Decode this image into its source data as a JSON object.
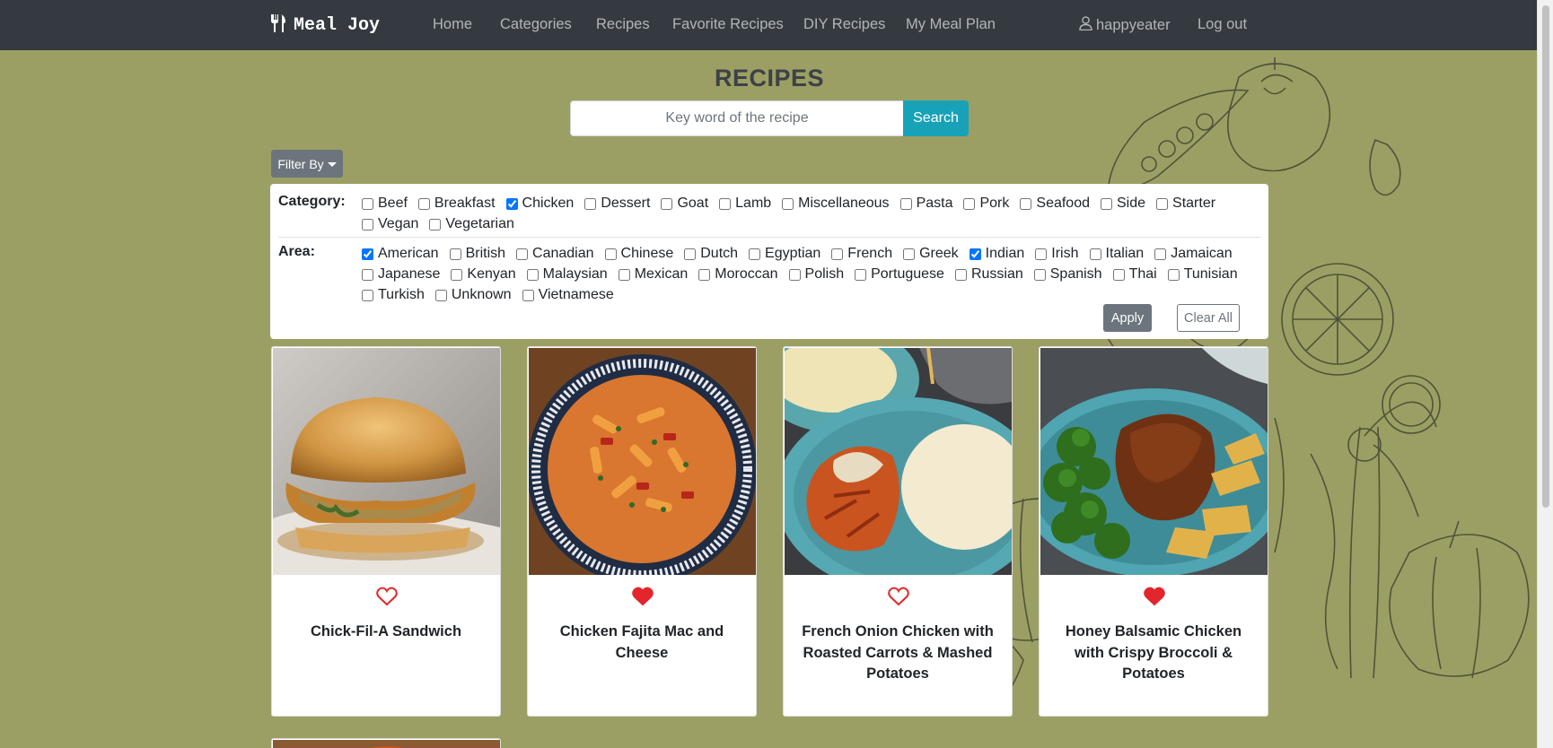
{
  "navbar": {
    "brand": "Meal Joy",
    "links": [
      "Home",
      "Categories",
      "Recipes",
      "Favorite Recipes",
      "DIY Recipes",
      "My Meal Plan"
    ],
    "user": "happyeater",
    "logout": "Log out"
  },
  "page": {
    "title": "RECIPES",
    "search_placeholder": "Key word of the recipe",
    "search_button": "Search",
    "filter_button": "Filter By"
  },
  "filter": {
    "category_label": "Category:",
    "categories": [
      {
        "label": "Beef",
        "checked": false
      },
      {
        "label": "Breakfast",
        "checked": false
      },
      {
        "label": "Chicken",
        "checked": true
      },
      {
        "label": "Dessert",
        "checked": false
      },
      {
        "label": "Goat",
        "checked": false
      },
      {
        "label": "Lamb",
        "checked": false
      },
      {
        "label": "Miscellaneous",
        "checked": false
      },
      {
        "label": "Pasta",
        "checked": false
      },
      {
        "label": "Pork",
        "checked": false
      },
      {
        "label": "Seafood",
        "checked": false
      },
      {
        "label": "Side",
        "checked": false
      },
      {
        "label": "Starter",
        "checked": false
      },
      {
        "label": "Vegan",
        "checked": false
      },
      {
        "label": "Vegetarian",
        "checked": false
      }
    ],
    "area_label": "Area:",
    "areas": [
      {
        "label": "American",
        "checked": true
      },
      {
        "label": "British",
        "checked": false
      },
      {
        "label": "Canadian",
        "checked": false
      },
      {
        "label": "Chinese",
        "checked": false
      },
      {
        "label": "Dutch",
        "checked": false
      },
      {
        "label": "Egyptian",
        "checked": false
      },
      {
        "label": "French",
        "checked": false
      },
      {
        "label": "Greek",
        "checked": false
      },
      {
        "label": "Indian",
        "checked": true
      },
      {
        "label": "Irish",
        "checked": false
      },
      {
        "label": "Italian",
        "checked": false
      },
      {
        "label": "Jamaican",
        "checked": false
      },
      {
        "label": "Japanese",
        "checked": false
      },
      {
        "label": "Kenyan",
        "checked": false
      },
      {
        "label": "Malaysian",
        "checked": false
      },
      {
        "label": "Mexican",
        "checked": false
      },
      {
        "label": "Moroccan",
        "checked": false
      },
      {
        "label": "Polish",
        "checked": false
      },
      {
        "label": "Portuguese",
        "checked": false
      },
      {
        "label": "Russian",
        "checked": false
      },
      {
        "label": "Spanish",
        "checked": false
      },
      {
        "label": "Thai",
        "checked": false
      },
      {
        "label": "Tunisian",
        "checked": false
      },
      {
        "label": "Turkish",
        "checked": false
      },
      {
        "label": "Unknown",
        "checked": false
      },
      {
        "label": "Vietnamese",
        "checked": false
      }
    ],
    "apply": "Apply",
    "clear": "Clear All"
  },
  "recipes": [
    {
      "title": "Chick-Fil-A Sandwich",
      "favorite": false
    },
    {
      "title": "Chicken Fajita Mac and Cheese",
      "favorite": true
    },
    {
      "title": "French Onion Chicken with Roasted Carrots & Mashed Potatoes",
      "favorite": false
    },
    {
      "title": "Honey Balsamic Chicken with Crispy Broccoli & Potatoes",
      "favorite": true
    }
  ],
  "colors": {
    "page_bg": "#9c9f64",
    "navbar_bg": "#343a40",
    "accent": "#17a2b8",
    "heart": "#e3262b"
  }
}
